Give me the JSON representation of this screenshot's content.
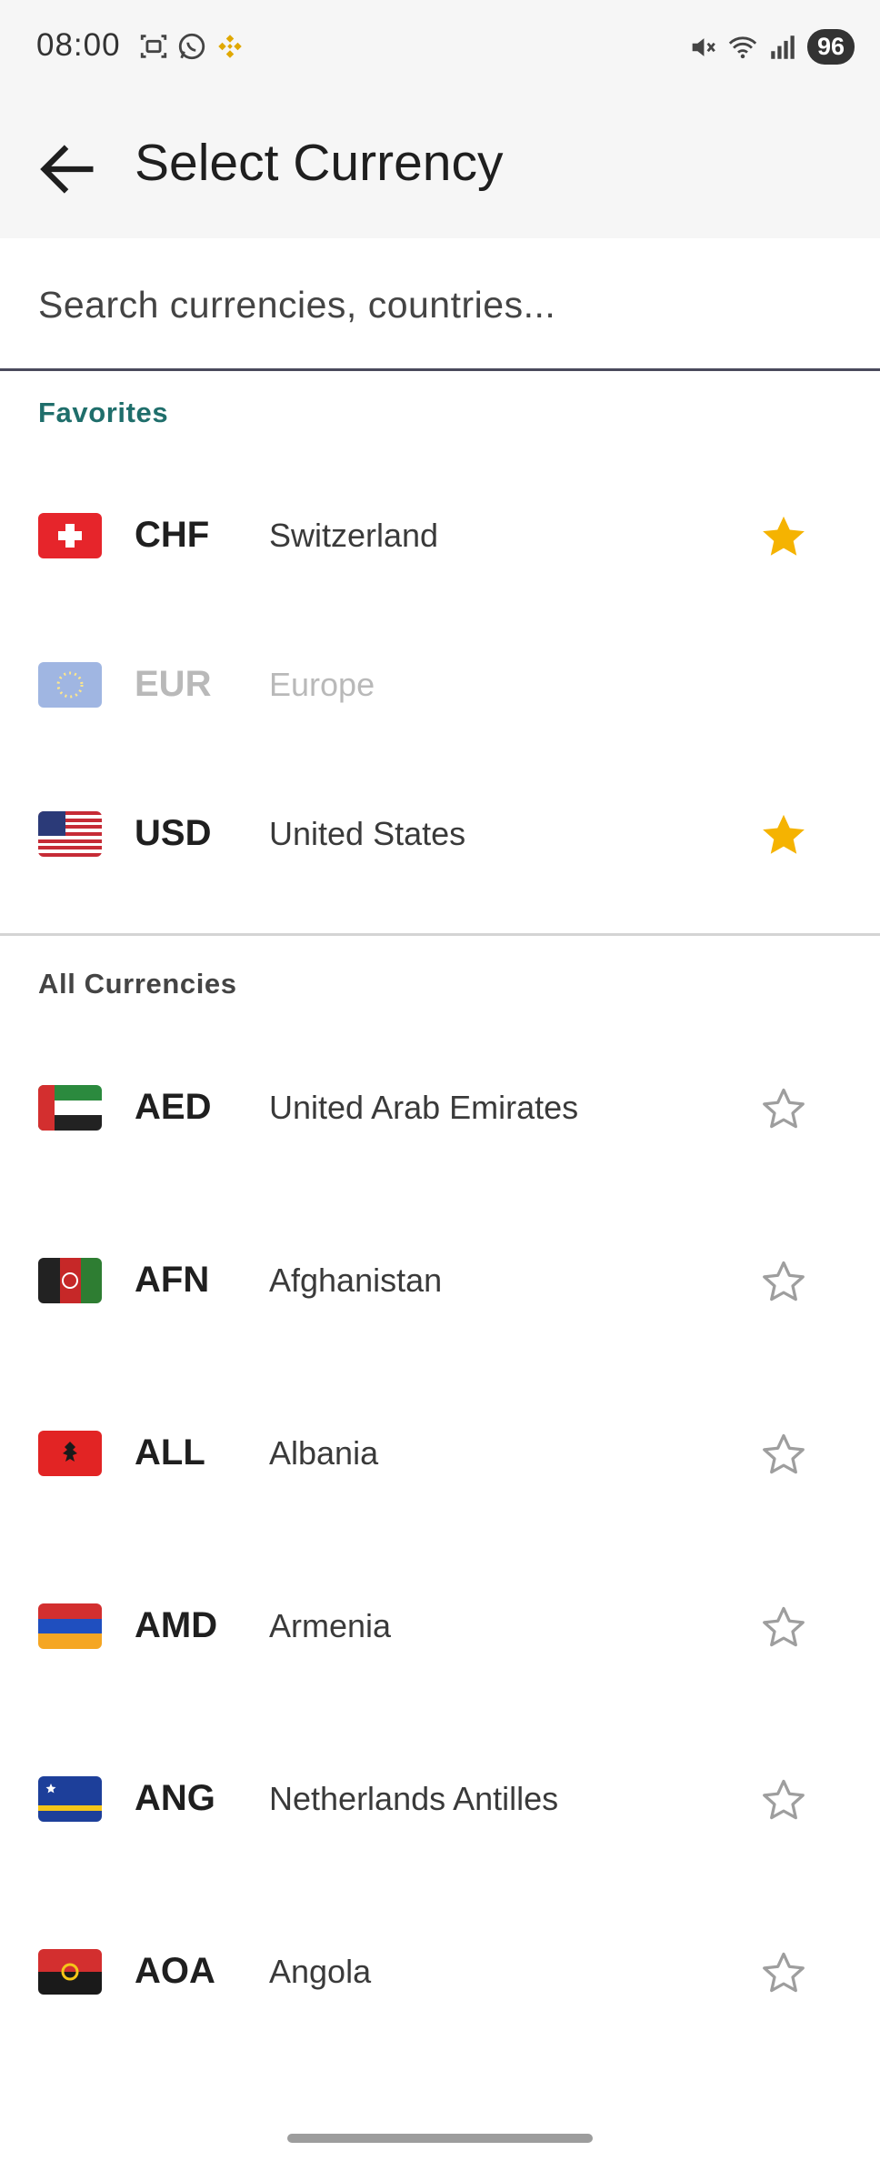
{
  "status_bar": {
    "time": "08:00",
    "battery": "96",
    "left_icons": [
      "screenshot-icon",
      "whatsapp-icon",
      "binance-icon"
    ],
    "right_icons": [
      "mute-icon",
      "wifi-icon",
      "signal-icon"
    ]
  },
  "app_bar": {
    "title": "Select Currency",
    "back_icon": "arrow-back-icon"
  },
  "search": {
    "placeholder": "Search currencies, countries...",
    "value": ""
  },
  "favorites": {
    "header": "Favorites",
    "items": [
      {
        "code": "CHF",
        "country": "Switzerland",
        "flag": "switzerland-flag-icon",
        "starred": true,
        "enabled": true
      },
      {
        "code": "EUR",
        "country": "Europe",
        "flag": "eu-flag-icon",
        "starred": false,
        "enabled": false
      },
      {
        "code": "USD",
        "country": "United States",
        "flag": "usa-flag-icon",
        "starred": true,
        "enabled": true
      }
    ]
  },
  "all_currencies": {
    "header": "All Currencies",
    "items": [
      {
        "code": "AED",
        "country": "United Arab Emirates",
        "flag": "uae-flag-icon",
        "starred": false
      },
      {
        "code": "AFN",
        "country": "Afghanistan",
        "flag": "afghanistan-flag-icon",
        "starred": false
      },
      {
        "code": "ALL",
        "country": "Albania",
        "flag": "albania-flag-icon",
        "starred": false
      },
      {
        "code": "AMD",
        "country": "Armenia",
        "flag": "armenia-flag-icon",
        "starred": false
      },
      {
        "code": "ANG",
        "country": "Netherlands Antilles",
        "flag": "curacao-flag-icon",
        "starred": false
      },
      {
        "code": "AOA",
        "country": "Angola",
        "flag": "angola-flag-icon",
        "starred": false
      }
    ]
  },
  "colors": {
    "accent": "#1f6e6b",
    "star_filled": "#f5b301",
    "star_empty": "#9e9e9e",
    "app_bar_bg": "#f6f6f6",
    "search_underline": "#4a4a5c"
  }
}
